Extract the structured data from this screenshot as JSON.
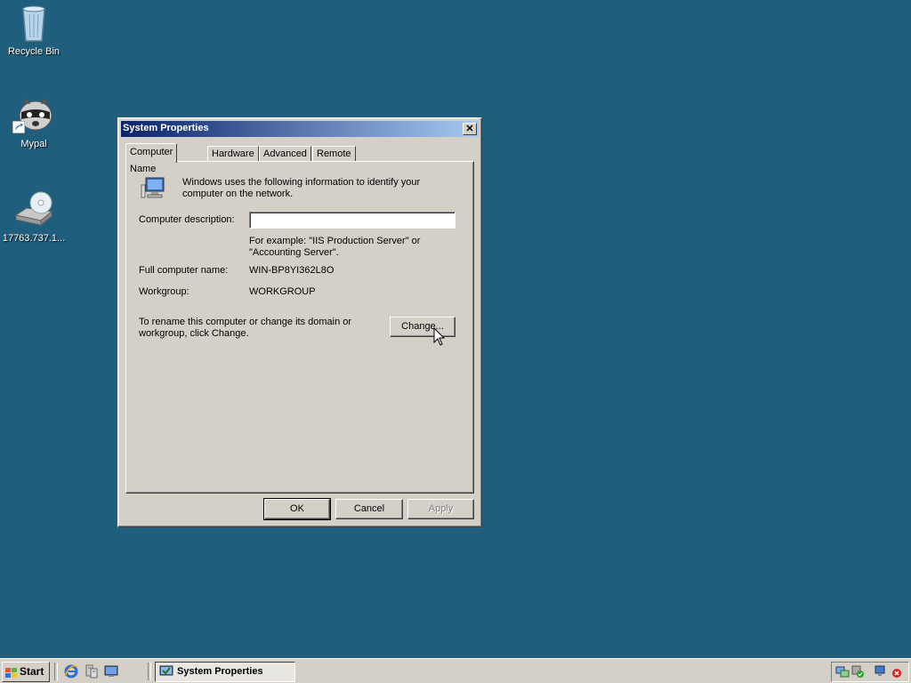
{
  "desktop": {
    "icons": [
      {
        "label": "Recycle Bin",
        "icon": "recycle-bin-icon"
      },
      {
        "label": "Mypal",
        "icon": "mypal-raccoon-icon"
      },
      {
        "label": "17763.737.1...",
        "icon": "dvd-drive-icon"
      }
    ]
  },
  "dialog": {
    "title": "System Properties",
    "close_label": "✕",
    "tabs": [
      "Computer Name",
      "Hardware",
      "Advanced",
      "Remote"
    ],
    "active_tab": "Computer Name",
    "intro_text": "Windows uses the following information to identify your computer on the network.",
    "description_label": "Computer description:",
    "description_value": "",
    "example_text": "For example: \"IIS Production Server\" or \"Accounting Server\".",
    "full_name_label": "Full computer name:",
    "full_name_value": "WIN-BP8YI362L8O",
    "workgroup_label": "Workgroup:",
    "workgroup_value": "WORKGROUP",
    "rename_text": "To rename this computer or change its domain or workgroup, click Change.",
    "change_button": "Change...",
    "ok_button": "OK",
    "cancel_button": "Cancel",
    "apply_button": "Apply"
  },
  "taskbar": {
    "start_label": "Start",
    "quick_launch": [
      "internet-explorer-icon",
      "server-manager-icon",
      "show-desktop-icon"
    ],
    "task_label": "System Properties",
    "tray_icons": [
      "network-icon",
      "security-icon",
      "network-connection-icon",
      "alert-icon"
    ]
  },
  "colors": {
    "desktop": "#1f5e7c",
    "title_start": "#0a246a",
    "title_end": "#a6caf0",
    "face": "#d4d0c8"
  }
}
